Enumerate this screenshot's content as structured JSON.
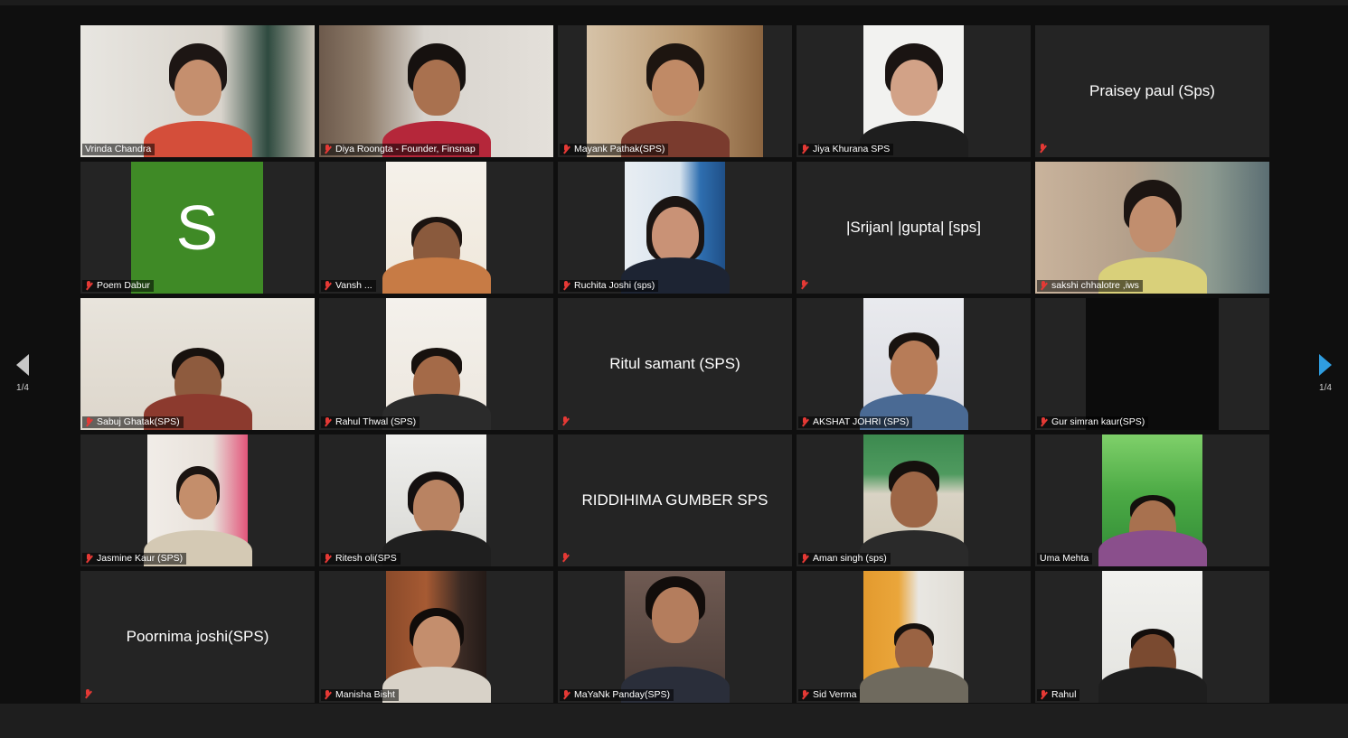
{
  "pagination": {
    "left_page": "1/4",
    "right_page": "1/4"
  },
  "participants": [
    {
      "name": "Vrinda Chandra",
      "video": true,
      "muted": false
    },
    {
      "name": "Diya Roongta - Founder, Finsnap",
      "video": true,
      "muted": true,
      "active_speaker": true
    },
    {
      "name": "Mayank Pathak(SPS)",
      "video": true,
      "muted": true
    },
    {
      "name": "Jiya Khurana SPS",
      "video": true,
      "muted": true
    },
    {
      "name": "Praisey paul (Sps)",
      "video": false,
      "muted": true
    },
    {
      "name": "Poem Dabur",
      "video": false,
      "avatar_letter": "S",
      "muted": true
    },
    {
      "name": "Vansh ...",
      "video": true,
      "muted": true
    },
    {
      "name": "Ruchita Joshi (sps)",
      "video": true,
      "muted": true
    },
    {
      "name": "|Srijan| |gupta| [sps]",
      "video": false,
      "muted": true
    },
    {
      "name": "sakshi chhalotre ,iws",
      "video": true,
      "muted": true
    },
    {
      "name": "Sabuj Ghatak(SPS)",
      "video": true,
      "muted": true
    },
    {
      "name": "Rahul Thwal (SPS)",
      "video": true,
      "muted": true
    },
    {
      "name": "Ritul samant (SPS)",
      "video": false,
      "muted": true
    },
    {
      "name": "AKSHAT JOHRI (SPS)",
      "video": true,
      "muted": true
    },
    {
      "name": "Gur simran kaur(SPS)",
      "video": true,
      "muted": true
    },
    {
      "name": "Jasmine Kaur (SPS)",
      "video": true,
      "muted": true
    },
    {
      "name": "Ritesh oli(SPS",
      "video": true,
      "muted": true
    },
    {
      "name": "RIDDIHIMA GUMBER SPS",
      "video": false,
      "muted": true
    },
    {
      "name": "Aman singh (sps)",
      "video": true,
      "muted": true
    },
    {
      "name": "Uma Mehta",
      "video": true,
      "muted": false
    },
    {
      "name": "Poornima joshi(SPS)",
      "video": false,
      "muted": true
    },
    {
      "name": "Manisha Bisht",
      "video": true,
      "muted": true
    },
    {
      "name": "MaYaNk Panday(SPS)",
      "video": true,
      "muted": true
    },
    {
      "name": "Sid Verma",
      "video": true,
      "muted": true
    },
    {
      "name": "Rahul",
      "video": true,
      "muted": true
    }
  ],
  "colors": {
    "active_speaker_border": "#d7dc7a",
    "mute_icon": "#e53935",
    "avatar_bg": "#3f8a26",
    "next_arrow": "#2f9de0"
  }
}
